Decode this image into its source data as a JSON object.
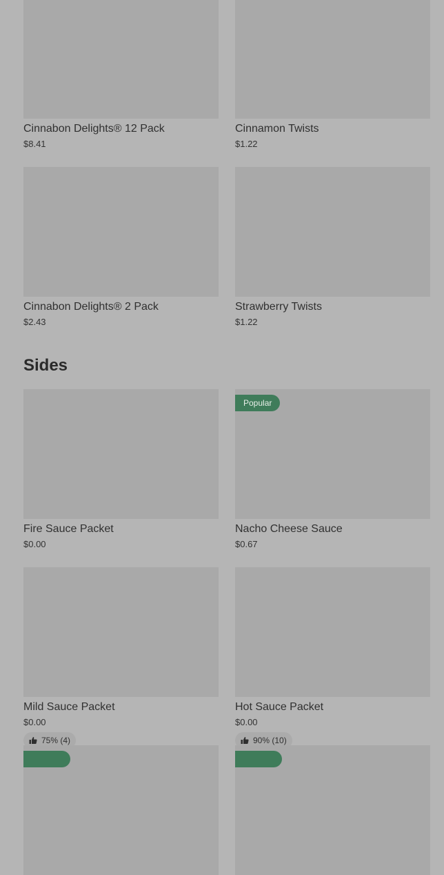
{
  "top_items": [
    {
      "name": "Cinnabon Delights® 12 Pack",
      "price": "$8.41"
    },
    {
      "name": "Cinnamon Twists",
      "price": "$1.22"
    },
    {
      "name": "Cinnabon Delights® 2 Pack",
      "price": "$2.43"
    },
    {
      "name": "Strawberry Twists",
      "price": "$1.22"
    }
  ],
  "sides": {
    "title": "Sides",
    "items": [
      {
        "name": "Fire Sauce Packet",
        "price": "$0.00"
      },
      {
        "name": "Nacho Cheese Sauce",
        "price": "$0.67",
        "badge": "Popular"
      },
      {
        "name": "Mild Sauce Packet",
        "price": "$0.00",
        "rating": "75% (4)"
      },
      {
        "name": "Hot Sauce Packet",
        "price": "$0.00",
        "rating": "90% (10)"
      }
    ]
  },
  "icons": {
    "rating": "thumbs-up-icon"
  },
  "colors": {
    "background": "#b5b5b5",
    "placeholder": "#a9a9a9",
    "badge": "#3f7c5a"
  }
}
